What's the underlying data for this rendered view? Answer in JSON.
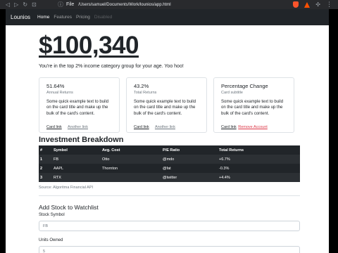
{
  "browser": {
    "protocol": "File",
    "url": "/Users/samuel/Documents/Work/lounios/app.html"
  },
  "navbar": {
    "brand": "Lounios",
    "links": [
      {
        "label": "Home"
      },
      {
        "label": "Features"
      },
      {
        "label": "Pricing"
      },
      {
        "label": "Disabled"
      }
    ]
  },
  "hero": {
    "balance": "$100,340",
    "lead": "You're in the top 2% income category group for your age. Yoo hoo!"
  },
  "cards": [
    {
      "title": "51.64%",
      "subtitle": "Annual Returns",
      "text": "Some quick example text to build on the card title and make up the bulk of the card's content.",
      "link1": "Card link",
      "link2": "Another link"
    },
    {
      "title": "43.2%",
      "subtitle": "Total Returns",
      "text": "Some quick example text to build on the card title and make up the bulk of the card's content.",
      "link1": "Card link",
      "link2": "Another link"
    },
    {
      "title": "Percentage Change",
      "subtitle": "Card subtitle",
      "text": "Some quick example text to build on the card title and make up the bulk of the card's content.",
      "link1": "Card link",
      "link2": "Remove Account"
    }
  ],
  "investment": {
    "heading": "Investment Breakdown",
    "headers": [
      "#",
      "Symbol",
      "Avg. Cost",
      "P/E Ratio",
      "Total Returns"
    ],
    "rows": [
      [
        "1",
        "FB",
        "Otto",
        "@mdo",
        "+6.7%"
      ],
      [
        "2",
        "AAPL",
        "Thornton",
        "@fat",
        "-0.3%"
      ],
      [
        "3",
        "RTX",
        "",
        "@twitter",
        "+4.4%"
      ]
    ],
    "source": "Source: Algoritma Financial API"
  },
  "watchlist": {
    "heading": "Add Stock to Watchlist",
    "symbol_label": "Stock Symbol",
    "symbol_value": "FB",
    "units_label": "Units Owned",
    "units_value": "5"
  }
}
